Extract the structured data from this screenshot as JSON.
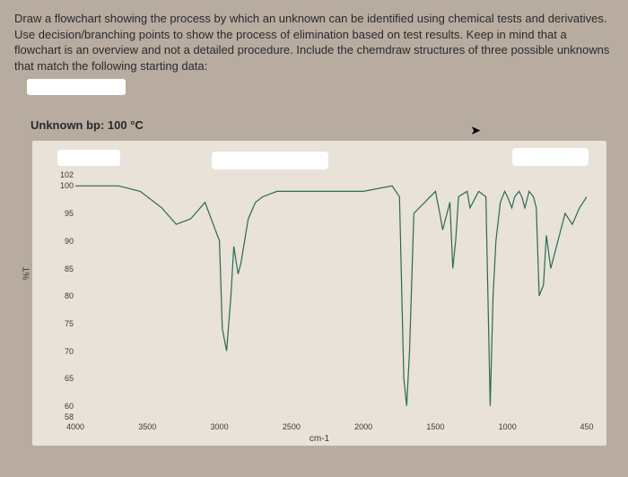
{
  "instructions": "Draw a flowchart showing the process by which an unknown can be identified using chemical tests and derivatives. Use decision/branching points to show the process of elimination based on test results. Keep in mind that a flowchart is an overview and not a detailed procedure. Include the chemdraw structures of three possible unknowns that match the following starting data:",
  "subtitle": "Unknown bp: 100 °C",
  "chart_data": {
    "type": "line",
    "title": "",
    "xlabel": "cm-1",
    "ylabel": "%T",
    "xlim": [
      4000,
      450
    ],
    "ylim": [
      58,
      102
    ],
    "x_ticks": [
      4000,
      3500,
      3000,
      2500,
      2000,
      1500,
      1000,
      450
    ],
    "y_ticks": [
      102,
      100,
      95,
      90,
      85,
      80,
      75,
      70,
      65,
      60,
      58
    ],
    "series": [
      {
        "name": "IR spectrum",
        "color": "#2a6a55",
        "x": [
          4000,
          3700,
          3550,
          3400,
          3300,
          3200,
          3100,
          3000,
          2980,
          2950,
          2920,
          2900,
          2870,
          2850,
          2800,
          2750,
          2700,
          2600,
          2400,
          2200,
          2000,
          1800,
          1750,
          1720,
          1700,
          1680,
          1650,
          1500,
          1470,
          1450,
          1430,
          1400,
          1380,
          1360,
          1340,
          1280,
          1260,
          1240,
          1200,
          1150,
          1120,
          1100,
          1080,
          1050,
          1020,
          1000,
          970,
          950,
          920,
          900,
          880,
          850,
          820,
          800,
          780,
          750,
          730,
          700,
          650,
          600,
          550,
          500,
          450
        ],
        "values": [
          100,
          100,
          99,
          96,
          93,
          94,
          97,
          90,
          74,
          70,
          80,
          89,
          84,
          86,
          94,
          97,
          98,
          99,
          99,
          99,
          99,
          100,
          98,
          65,
          60,
          70,
          95,
          99,
          95,
          92,
          94,
          97,
          85,
          90,
          98,
          99,
          96,
          97,
          99,
          98,
          60,
          80,
          90,
          97,
          99,
          98,
          96,
          98,
          99,
          98,
          96,
          99,
          98,
          96,
          80,
          82,
          91,
          85,
          90,
          95,
          93,
          96,
          98
        ]
      }
    ]
  }
}
